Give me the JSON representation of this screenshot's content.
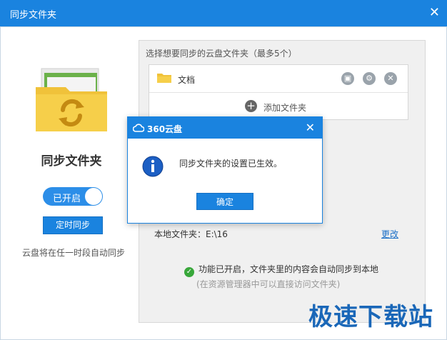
{
  "window": {
    "title": "同步文件夹",
    "close_icon": "close-icon"
  },
  "left": {
    "title": "同步文件夹",
    "toggle_label": "已开启",
    "timer_button": "定时同步",
    "note": "云盘将在任一时段自动同步"
  },
  "panel": {
    "header": "选择想要同步的云盘文件夹（最多5个）",
    "folders": [
      {
        "name": "文档"
      }
    ],
    "add_label": "添加文件夹",
    "local_folder": "本地文件夹：E:\\16",
    "change_link": "更改",
    "status": "功能已开启，文件夹里的内容会自动同步到本地",
    "hint": "(在资源管理器中可以直接访问文件夹)"
  },
  "dialog": {
    "title": "360云盘",
    "message": "同步文件夹的设置已生效。",
    "ok_label": "确定"
  },
  "watermark": "极速下载站",
  "colors": {
    "accent": "#1a83df",
    "success": "#38a73a",
    "link": "#1a6fc7"
  }
}
